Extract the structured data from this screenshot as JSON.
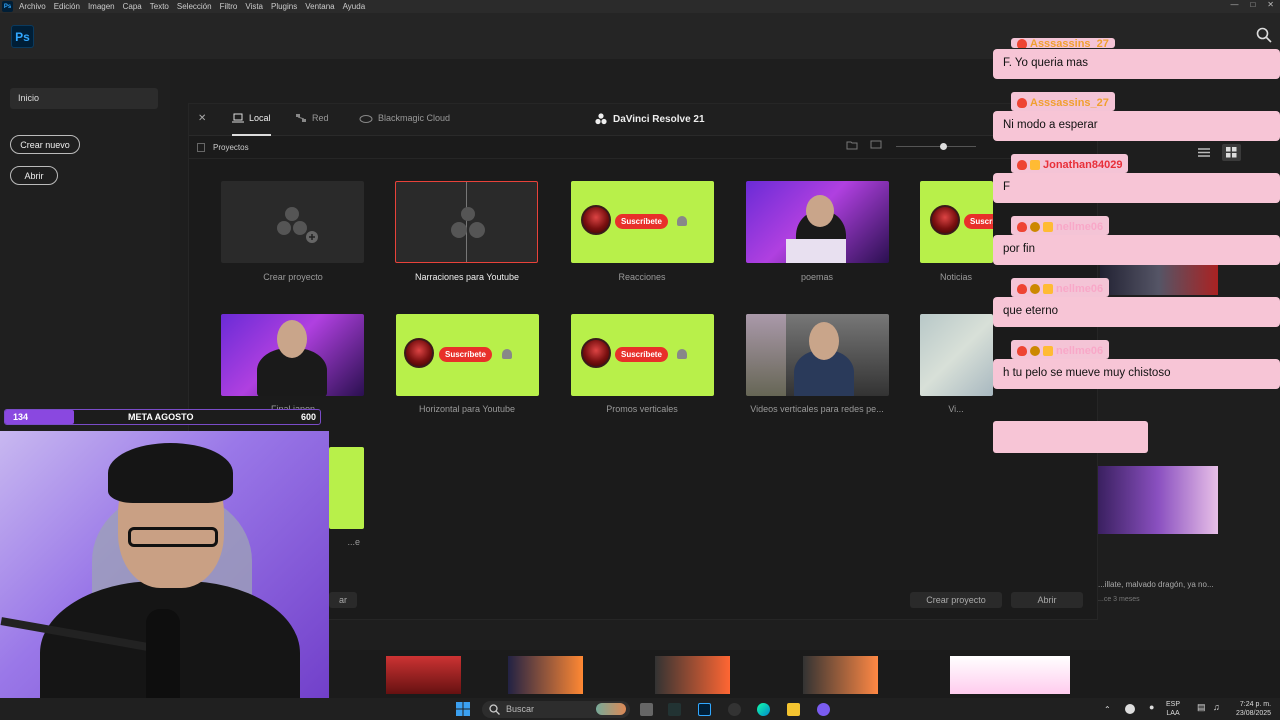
{
  "menubar": {
    "app_icon": "Ps",
    "items": [
      "Archivo",
      "Edición",
      "Imagen",
      "Capa",
      "Texto",
      "Selección",
      "Filtro",
      "Vista",
      "Plugins",
      "Ventana",
      "Ayuda"
    ]
  },
  "photoshop": {
    "logo": "Ps",
    "home_label": "Inicio",
    "create_new": "Crear nuevo",
    "open": "Abrir"
  },
  "davinci": {
    "tabs": [
      "Local",
      "Red",
      "Blackmagic Cloud"
    ],
    "title": "DaVinci Resolve 21",
    "section": "Proyectos",
    "projects": [
      {
        "label": "Crear proyecto"
      },
      {
        "label": "Narraciones para Youtube"
      },
      {
        "label": "Reacciones"
      },
      {
        "label": "poemas"
      },
      {
        "label": "Noticias"
      },
      {
        "label": "Final japon"
      },
      {
        "label": "Horizontal para Youtube"
      },
      {
        "label": "Promos verticales"
      },
      {
        "label": "Videos verticales para redes pe..."
      },
      {
        "label": "Vi..."
      },
      {
        "label": "...e"
      }
    ],
    "subscribe_label": "Suscríbete",
    "btn_create": "Crear proyecto",
    "btn_open": "Abrir",
    "btn_partial": "ar"
  },
  "right_panel": {
    "video_title": "...illate, malvado dragón, ya no...",
    "video_meta": "...ce 3 meses"
  },
  "chat": {
    "messages": [
      {
        "user": "Asssassins_27",
        "text": "F. Yo queria mas"
      },
      {
        "user": "Asssassins_27",
        "text": "Ni modo a esperar"
      },
      {
        "user": "Jonathan84029",
        "text": "F"
      },
      {
        "user": "nellme06",
        "text": "por fin"
      },
      {
        "user": "nellme06",
        "text": "que eterno"
      },
      {
        "user": "nellme06",
        "text": "h tu pelo se mueve muy chistoso"
      }
    ]
  },
  "goal": {
    "current": "134",
    "title": "META AGOSTO",
    "target": "600",
    "progress": 0.22
  },
  "taskbar": {
    "search": "Buscar",
    "lang": "ESP",
    "lang2": "LAA",
    "time": "7:24 p. m.",
    "date": "23/08/2025"
  },
  "colors": {
    "green_thumb": "#b8f04a",
    "chat_bubble": "#f7c5d6",
    "goal_purple": "#8a48e0",
    "ps_blue": "#31a8ff"
  }
}
